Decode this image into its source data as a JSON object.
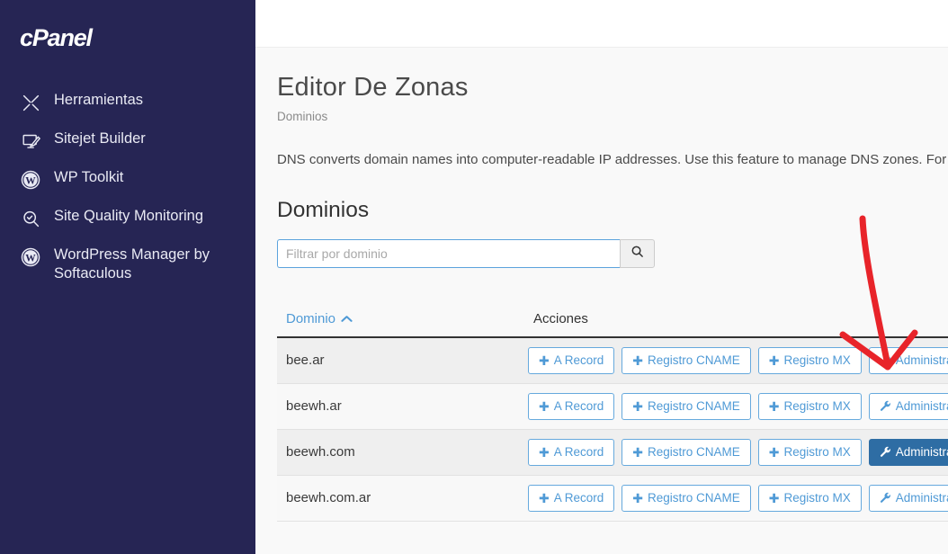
{
  "brand": {
    "name": "cPanel"
  },
  "sidebar": {
    "items": [
      {
        "label": "Herramientas",
        "icon": "tools-icon"
      },
      {
        "label": "Sitejet Builder",
        "icon": "monitor-pen-icon"
      },
      {
        "label": "WP Toolkit",
        "icon": "wordpress-icon"
      },
      {
        "label": "Site Quality Monitoring",
        "icon": "magnifier-check-icon"
      },
      {
        "label": "WordPress Manager by Softaculous",
        "icon": "wordpress-icon"
      }
    ]
  },
  "page": {
    "title": "Editor De Zonas",
    "breadcrumb": "Dominios",
    "intro": "DNS converts domain names into computer-readable IP addresses. Use this feature to manage DNS zones. For mo",
    "section_title": "Dominios"
  },
  "filter": {
    "placeholder": "Filtrar por dominio",
    "value": "",
    "search_icon": "search-icon"
  },
  "table": {
    "columns": [
      "Dominio",
      "Acciones"
    ],
    "sort": {
      "column": "Dominio",
      "direction": "asc",
      "icon": "chevron-up-icon"
    },
    "action_labels": {
      "a_record": "A Record",
      "cname": "Registro CNAME",
      "mx": "Registro MX",
      "manage": "Administrar"
    },
    "rows": [
      {
        "domain": "bee.ar",
        "manage_active": false
      },
      {
        "domain": "beewh.ar",
        "manage_active": false
      },
      {
        "domain": "beewh.com",
        "manage_active": true
      },
      {
        "domain": "beewh.com.ar",
        "manage_active": false
      }
    ]
  },
  "annotation": {
    "type": "arrow",
    "color": "#e8242a",
    "points_to": "manage-button-row-1"
  },
  "colors": {
    "sidebar_bg": "#262554",
    "accent_blue": "#4f9ad6",
    "active_blue": "#2e6da4",
    "annotation_red": "#e8242a"
  }
}
